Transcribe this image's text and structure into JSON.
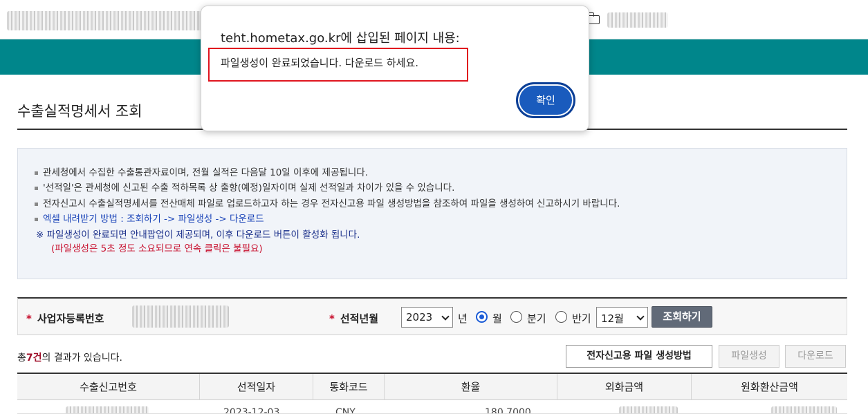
{
  "dialog": {
    "title": "teht.hometax.go.kr에 삽입된 페이지 내용:",
    "message": "파일생성이 완료되었습니다. 다운로드 하세요.",
    "ok_label": "확인"
  },
  "page": {
    "title": "수출실적명세서 조회"
  },
  "info": {
    "line1": "관세청에서 수집한 수출통관자료이며, 전월 실적은 다음달 10일 이후에 제공됩니다.",
    "line2": "'선적일'은 관세청에 신고된 수출 적하목록 상 출항(예정)일자이며 실제 선적일과 차이가 있을 수 있습니다.",
    "line3": "전자신고시 수출실적명세서를 전산매체 파일로 업로드하고자 하는 경우 전자신고용 파일 생성방법을 참조하여 파일을 생성하여 신고하시기 바랍니다.",
    "line4": "엑셀 내려받기 방법 :  조회하기 ->   파일생성 -> 다운로드",
    "line5": "※ 파일생성이 완료되면 안내팝업이 제공되며, 이후   다운로드 버튼이 활성화 됩니다.",
    "line6": "(파일생성은 5초 정도 소요되므로 연속 클릭은 불필요)"
  },
  "search": {
    "required_mark": "*",
    "bizno_label": "사업자등록번호",
    "period_label": "선적년월",
    "year_value": "2023",
    "year_suffix": "년",
    "radio_month": "월",
    "radio_quarter": "분기",
    "radio_half": "반기",
    "month_value": "12월",
    "search_button": "조회하기"
  },
  "result": {
    "prefix": "총",
    "count": "7건",
    "suffix": "의 결과가 있습니다."
  },
  "actions": {
    "method_button": "전자신고용 파일 생성방법",
    "create_button": "파일생성",
    "download_button": "다운로드"
  },
  "table": {
    "headers": [
      "수출신고번호",
      "선적일자",
      "통화코드",
      "환율",
      "외화금액",
      "원화환산금액"
    ],
    "first_row": {
      "date": "2023-12-03",
      "currency": "CNY",
      "rate": "180.7000"
    }
  },
  "colors": {
    "teal_band": "#00868b",
    "accent_blue": "#1a5bbd",
    "alert_red": "#e0141e"
  }
}
